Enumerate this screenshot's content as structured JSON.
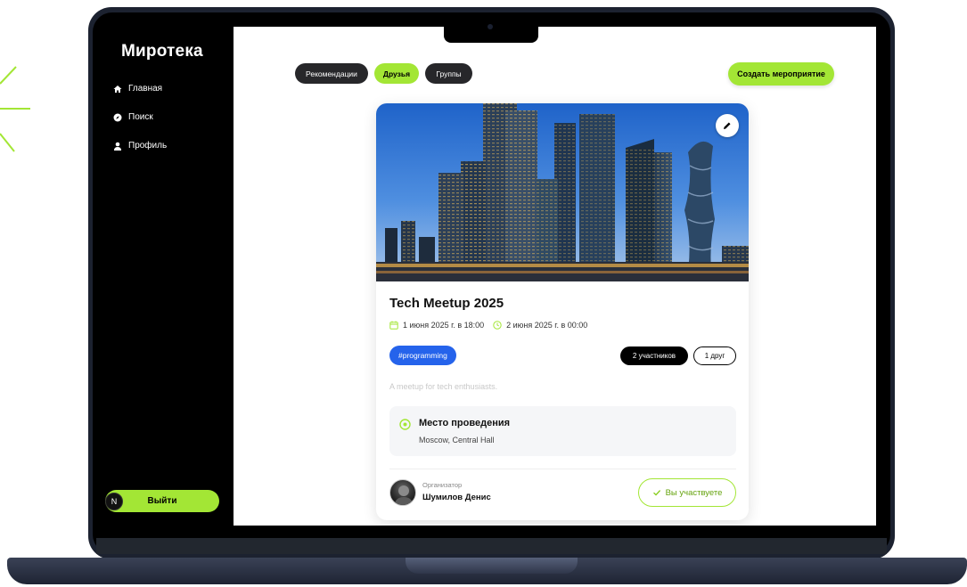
{
  "sidebar": {
    "logo": "Миротека",
    "nav": [
      {
        "label": "Главная",
        "icon": "home-icon"
      },
      {
        "label": "Поиск",
        "icon": "compass-icon"
      },
      {
        "label": "Профиль",
        "icon": "user-icon"
      }
    ],
    "logout_label": "Выйти",
    "badge": "N"
  },
  "tabs": [
    {
      "label": "Рекомендации",
      "active": false
    },
    {
      "label": "Друзья",
      "active": true
    },
    {
      "label": "Группы",
      "active": false
    }
  ],
  "create_event_label": "Создать мероприятие",
  "event": {
    "title": "Tech Meetup 2025",
    "start": "1 июня 2025 г. в 18:00",
    "end": "2 июня 2025 г. в 00:00",
    "tag": "#programming",
    "participants": "2 участников",
    "friends": "1 друг",
    "description": "A meetup for tech enthusiasts.",
    "venue_title": "Место проведения",
    "venue_address": "Moscow, Central Hall",
    "organizer_label": "Организатор",
    "organizer_name": "Шумилов Денис",
    "attend_label": "Вы участвуете"
  },
  "colors": {
    "accent": "#a3e635",
    "tag_blue": "#2563eb",
    "sidebar_bg": "#000000"
  }
}
